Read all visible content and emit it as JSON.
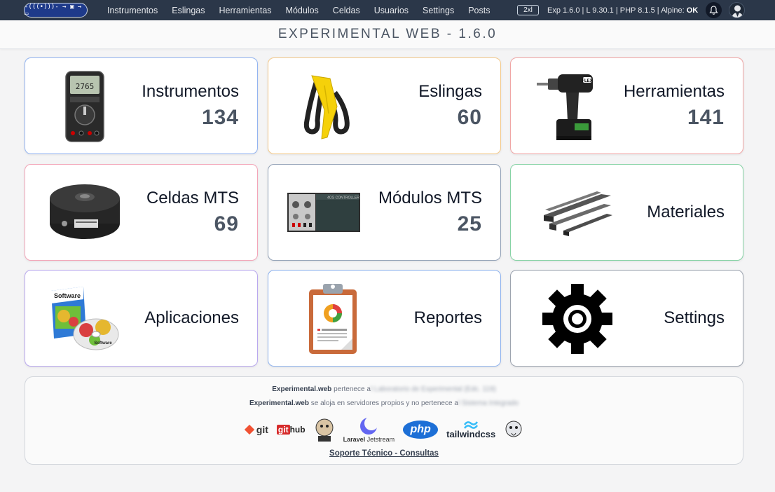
{
  "nav": {
    "brand_text": "-(((•)))- → ▣ → ▭",
    "links": [
      "Instrumentos",
      "Eslingas",
      "Herramientas",
      "Módulos",
      "Celdas",
      "Usuarios",
      "Settings",
      "Posts"
    ],
    "size_badge": "2xl",
    "versions_text": "Exp 1.6.0 | L 9.30.1 | PHP 8.1.5 | Alpine:",
    "alpine_status": "OK"
  },
  "title": "EXPERIMENTAL WEB - 1.6.0",
  "cards": [
    {
      "label": "Instrumentos",
      "count": "134",
      "icon": "multimeter-icon"
    },
    {
      "label": "Eslingas",
      "count": "60",
      "icon": "sling-icon"
    },
    {
      "label": "Herramientas",
      "count": "141",
      "icon": "drill-icon"
    },
    {
      "label": "Celdas MTS",
      "count": "69",
      "icon": "load-cell-icon"
    },
    {
      "label": "Módulos MTS",
      "count": "25",
      "icon": "module-icon"
    },
    {
      "label": "Materiales",
      "count": "",
      "icon": "steel-beams-icon"
    },
    {
      "label": "Aplicaciones",
      "count": "",
      "icon": "software-box-icon"
    },
    {
      "label": "Reportes",
      "count": "",
      "icon": "report-clipboard-icon"
    },
    {
      "label": "Settings",
      "count": "",
      "icon": "gear-icon"
    }
  ],
  "footer": {
    "line1_brand": "Experimental.web",
    "line1_text": " pertenece a",
    "line1_blurred": "l Laboratorio de Experimental (Edc. 119)",
    "line2_brand": "Experimental.web",
    "line2_text": " se aloja en servidores propios y no pertenece a",
    "line2_blurred": "l Sistema Integrado",
    "logos": [
      "git",
      "github",
      "laravel",
      "Laravel Jetstream",
      "php",
      "tailwindcss",
      "elephant"
    ],
    "logo_git": "git",
    "logo_github_a": "git",
    "logo_github_b": "hub",
    "logo_jetstream_a": "Laravel",
    "logo_jetstream_b": " Jetstream",
    "logo_php": "php",
    "logo_tailwind": "tailwindcss",
    "support_link": "Soporte Técnico - Consultas"
  },
  "colors": {
    "nav_bg": "#2b3749",
    "accent_blue": "#1e3a8a"
  }
}
